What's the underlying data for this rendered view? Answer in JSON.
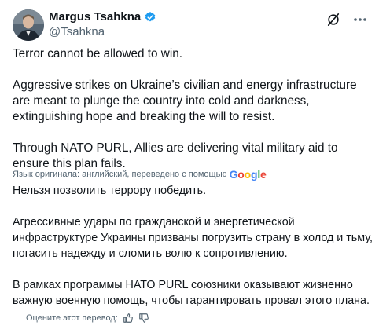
{
  "author": {
    "display_name": "Margus Tsahkna",
    "handle": "@Tsahkna",
    "verified": true
  },
  "header": {
    "grok_icon": "grok-icon",
    "more_icon": "more-icon"
  },
  "tweet": {
    "paragraphs": [
      "Terror cannot be allowed to win.",
      "Aggressive strikes on Ukraine’s civilian and energy infrastructure are meant to plunge the country into cold and darkness, extinguishing hope and breaking the will to resist.",
      "Through NATO PURL, Allies are delivering vital military aid to ensure this plan fails."
    ]
  },
  "translation": {
    "note": "Язык оригинала: английский, переведено с помощью",
    "provider": "Google",
    "paragraphs": [
      "Нельзя позволить террору победить.",
      "Агрессивные удары по гражданской и энергетической инфраструктуре Украины призваны погрузить страну в холод и тьму, погасить надежду и сломить волю к сопротивлению.",
      "В рамках программы НАТО PURL союзники оказывают жизненно важную военную помощь, чтобы гарантировать провал этого плана."
    ],
    "rate_label": "Оцените этот перевод:"
  },
  "colors": {
    "text": "#0f1419",
    "secondary": "#536471",
    "verified": "#1d9bf0"
  }
}
